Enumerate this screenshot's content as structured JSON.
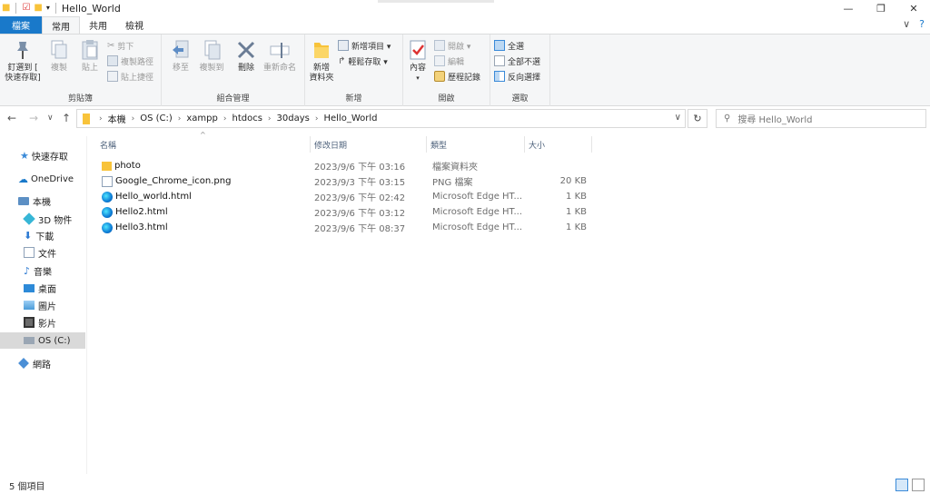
{
  "window": {
    "title": "Hello_World",
    "controls": {
      "minimize": "—",
      "maximize": "❐",
      "close": "✕"
    }
  },
  "ribbon_tabs": {
    "file": "檔案",
    "home": "常用",
    "share": "共用",
    "view": "檢視",
    "collapse": "∨",
    "help": "?"
  },
  "ribbon": {
    "clipboard": {
      "label": "剪貼簿",
      "pin_line1": "釘選到 [",
      "pin_line2": "快速存取]",
      "copy": "複製",
      "paste": "貼上",
      "cut": "剪下",
      "copy_path": "複製路徑",
      "paste_shortcut": "貼上捷徑"
    },
    "organize": {
      "label": "組合管理",
      "move_to": "移至",
      "copy_to": "複製到",
      "delete": "刪除",
      "rename": "重新命名"
    },
    "new": {
      "label": "新增",
      "new_folder_line1": "新增",
      "new_folder_line2": "資料夾",
      "new_item": "新增項目 ▾",
      "easy_access": "輕鬆存取 ▾"
    },
    "open": {
      "label": "開啟",
      "properties": "內容",
      "open": "開啟 ▾",
      "edit": "編輯",
      "history": "歷程記錄"
    },
    "select": {
      "label": "選取",
      "select_all": "全選",
      "select_none": "全部不選",
      "invert": "反向選擇"
    }
  },
  "address": {
    "crumbs": [
      "本機",
      "OS (C:)",
      "xampp",
      "htdocs",
      "30days",
      "Hello_World"
    ],
    "search_placeholder": "搜尋 Hello_World"
  },
  "nav_pane": {
    "quick_access": "快速存取",
    "onedrive": "OneDrive",
    "this_pc": "本機",
    "objects_3d": "3D 物件",
    "downloads": "下載",
    "documents": "文件",
    "music": "音樂",
    "desktop": "桌面",
    "pictures": "圖片",
    "videos": "影片",
    "os_c": "OS (C:)",
    "network": "網路"
  },
  "columns": {
    "name": "名稱",
    "date": "修改日期",
    "type": "類型",
    "size": "大小",
    "sort_indicator": "^"
  },
  "files": [
    {
      "name": "photo",
      "date": "2023/9/6 下午 03:16",
      "type": "檔案資料夾",
      "size": "",
      "icon": "folder-icon"
    },
    {
      "name": "Google_Chrome_icon.png",
      "date": "2023/9/3 下午 03:15",
      "type": "PNG 檔案",
      "size": "20 KB",
      "icon": "png-file-icon"
    },
    {
      "name": "Hello_world.html",
      "date": "2023/9/6 下午 02:42",
      "type": "Microsoft Edge HT...",
      "size": "1 KB",
      "icon": "edge-icon"
    },
    {
      "name": "Hello2.html",
      "date": "2023/9/6 下午 03:12",
      "type": "Microsoft Edge HT...",
      "size": "1 KB",
      "icon": "edge-icon"
    },
    {
      "name": "Hello3.html",
      "date": "2023/9/6 下午 08:37",
      "type": "Microsoft Edge HT...",
      "size": "1 KB",
      "icon": "edge-icon"
    }
  ],
  "status": {
    "item_count": "5 個項目"
  },
  "colors": {
    "accent": "#1979ca",
    "folder": "#f8c33a",
    "edge": "#0c7bd5",
    "selection": "#d9d9d9"
  }
}
